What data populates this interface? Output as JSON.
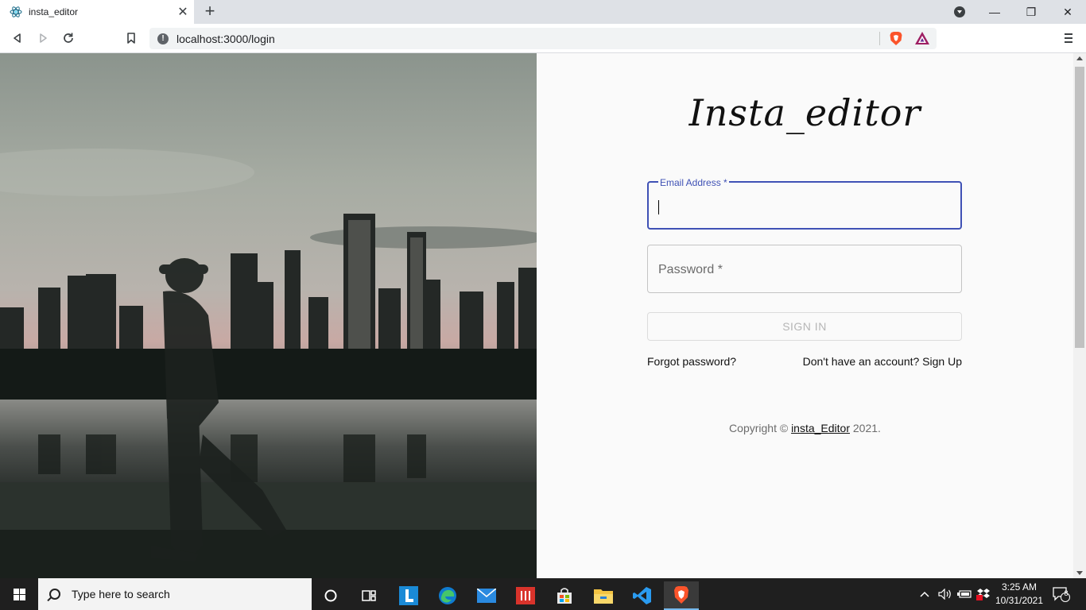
{
  "browser": {
    "tab_title": "insta_editor",
    "tab_close": "✕",
    "new_tab": "+",
    "url": "localhost:3000/login",
    "window_minimize": "—",
    "window_restore": "❐",
    "window_close": "✕"
  },
  "app": {
    "logo": "Insta_editor",
    "email_label": "Email Address *",
    "password_label": "Password *",
    "signin_label": "SIGN IN",
    "forgot_label": "Forgot password?",
    "signup_label": "Don't have an account? Sign Up",
    "copyright_prefix": "Copyright © ",
    "copyright_link": "insta_Editor",
    "copyright_suffix": " 2021.",
    "accent_color": "#3f51b5"
  },
  "taskbar": {
    "search_placeholder": "Type here to search",
    "time": "3:25 AM",
    "date": "10/31/2021",
    "notification_count": "8",
    "apps": [
      "cortana-icon",
      "task-view-icon",
      "l-app-icon",
      "edge-icon",
      "mail-icon",
      "red-app-icon",
      "store-icon",
      "file-explorer-icon",
      "vscode-icon",
      "brave-icon"
    ]
  }
}
